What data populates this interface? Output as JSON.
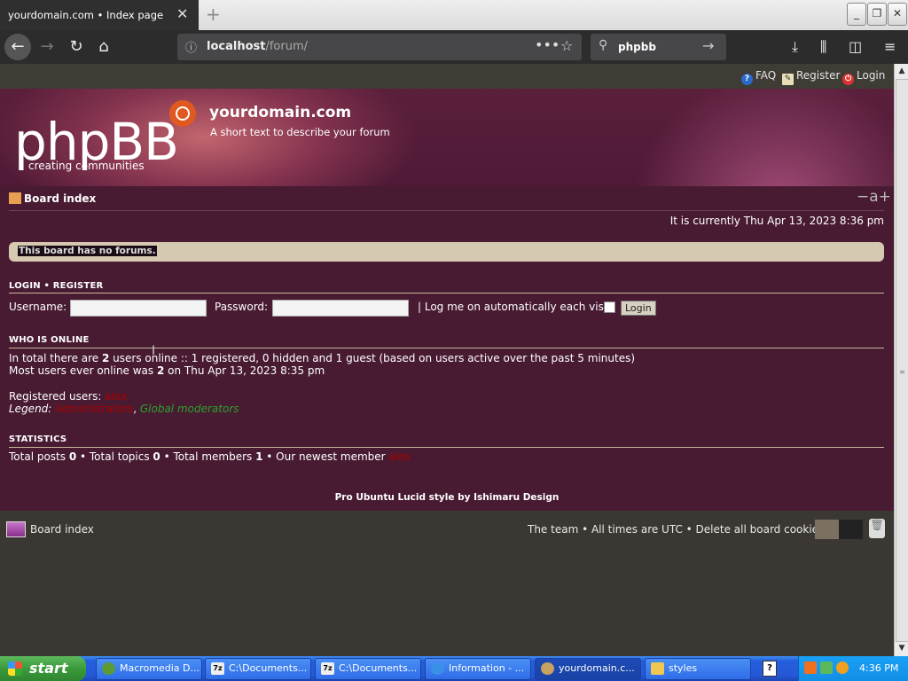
{
  "browser": {
    "tab_title": "yourdomain.com • Index page",
    "tab_close": "✕",
    "new_tab": "+",
    "url_host": "localhost",
    "url_path": "/forum/",
    "search_value": "phpbb",
    "window_buttons": {
      "minimize": "_",
      "restore": "❐",
      "close": "✕"
    }
  },
  "forum": {
    "top_links": {
      "faq": "FAQ",
      "register": "Register",
      "login": "Login"
    },
    "logo_text": "phpBB",
    "logo_tagline": "creating   communities",
    "site_name": "yourdomain.com",
    "site_description": "A short text to describe your forum",
    "breadcrumb": "Board index",
    "font_size_control": "−a+",
    "current_time": "It is currently Thu Apr 13, 2023 8:36 pm",
    "notice": "This board has no forums.",
    "login_section": {
      "header": "LOGIN  •  REGISTER",
      "username_label": "Username:",
      "password_label": "Password:",
      "username_value": "",
      "password_value": "",
      "autologin_label": "| Log me on automatically each visit",
      "login_button": "Login"
    },
    "who_is_online": {
      "header": "WHO IS ONLINE",
      "line1_pre": "In total there are ",
      "line1_count": "2",
      "line1_post": " users online :: 1 registered, 0 hidden and 1 guest (based on users active over the past 5 minutes)",
      "line2_pre": "Most users ever online was ",
      "line2_count": "2",
      "line2_post": " on Thu Apr 13, 2023 8:35 pm",
      "registered_label": "Registered users: ",
      "registered_user": "alex",
      "legend_label": "Legend: ",
      "legend_admins": "Administrators",
      "legend_sep": ", ",
      "legend_mods": "Global moderators"
    },
    "statistics": {
      "header": "STATISTICS",
      "total_posts_label": "Total posts ",
      "total_posts": "0",
      "total_topics_label": " • Total topics ",
      "total_topics": "0",
      "total_members_label": " • Total members ",
      "total_members": "1",
      "newest_label": " • Our newest member ",
      "newest_member": "alex"
    },
    "style_credit": "Pro Ubuntu Lucid style by Ishimaru Design",
    "footer": {
      "board_index": "Board index",
      "links": "The team • All times are UTC • Delete all board cookies"
    }
  },
  "taskbar": {
    "start": "start",
    "tasks": [
      {
        "label": "Macromedia D..."
      },
      {
        "label": "C:\\Documents..."
      },
      {
        "label": "C:\\Documents..."
      },
      {
        "label": "Information - ..."
      },
      {
        "label": "yourdomain.c..."
      },
      {
        "label": "styles"
      }
    ],
    "help": "?",
    "clock": "4:36 PM"
  },
  "colors": {
    "header_accent": "#c3656e",
    "main_bg": "#481b32",
    "admin_color": "#aa0000",
    "mod_color": "#2ba12b",
    "taskbar_blue": "#245edc"
  }
}
